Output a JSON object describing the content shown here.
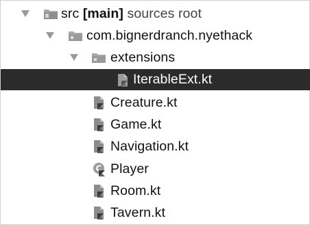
{
  "tree": {
    "root": {
      "name": "src",
      "branch": "[main]",
      "annotation": "sources root",
      "icon": "source-folder-icon",
      "expanded": true
    },
    "package": {
      "name": "com.bignerdranch.nyethack",
      "icon": "package-folder-icon",
      "expanded": true
    },
    "subpackage": {
      "name": "extensions",
      "icon": "package-folder-icon",
      "expanded": true
    },
    "files": [
      {
        "name": "IterableExt.kt",
        "icon": "kotlin-file-icon",
        "selected": true
      },
      {
        "name": "Creature.kt",
        "icon": "kotlin-file-icon",
        "selected": false
      },
      {
        "name": "Game.kt",
        "icon": "kotlin-file-icon",
        "selected": false
      },
      {
        "name": "Navigation.kt",
        "icon": "kotlin-file-icon",
        "selected": false
      },
      {
        "name": "Player",
        "icon": "kotlin-class-icon",
        "selected": false
      },
      {
        "name": "Room.kt",
        "icon": "kotlin-file-icon",
        "selected": false
      },
      {
        "name": "Tavern.kt",
        "icon": "kotlin-file-icon",
        "selected": false
      }
    ],
    "colors": {
      "selection_background": "#2b2b2b",
      "folder": "#9a9a9a",
      "file": "#8c8c8c",
      "text": "#111111"
    }
  }
}
